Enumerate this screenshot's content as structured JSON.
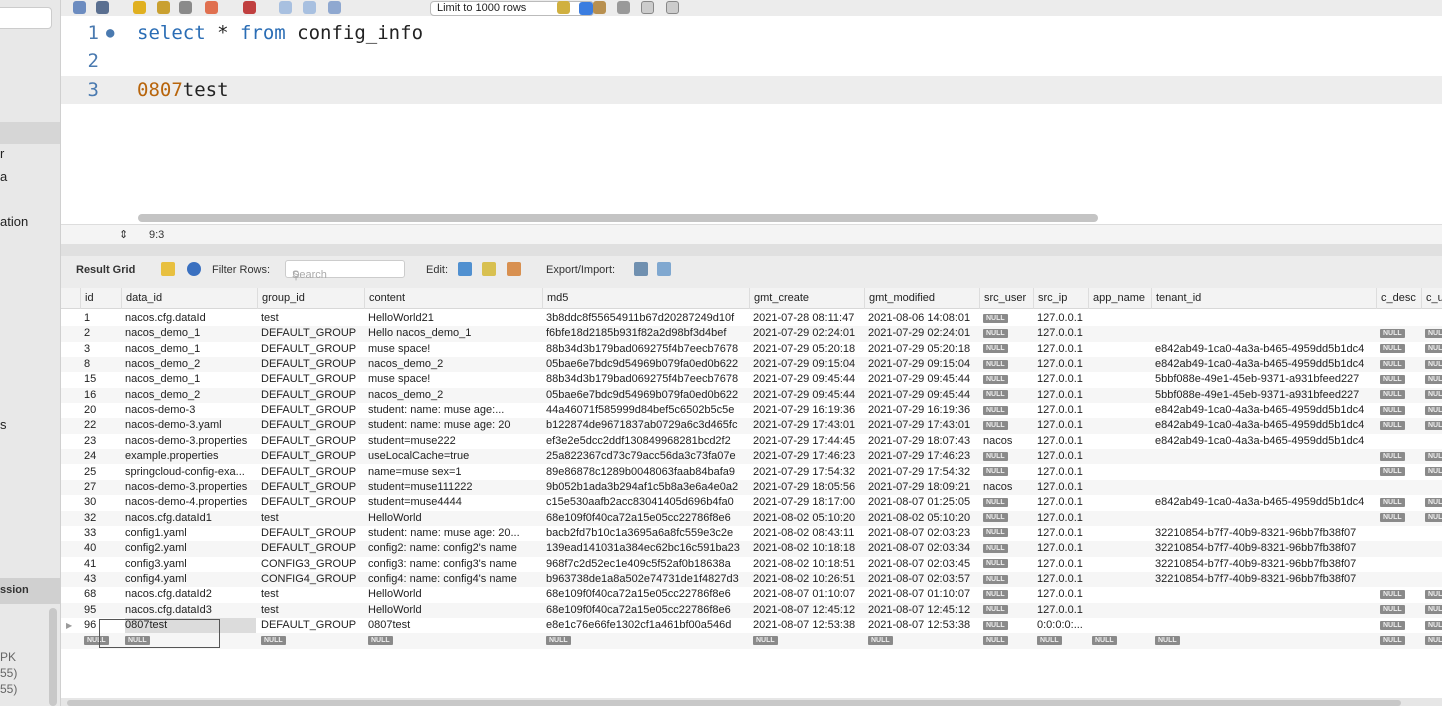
{
  "sidebar": {
    "labels": [
      "r",
      "a",
      "ation",
      "s"
    ],
    "session_header": "ssion",
    "info": [
      "PK",
      "55)",
      "55)"
    ]
  },
  "toolbar": {
    "limit_select": "Limit to 1000 rows"
  },
  "editor": {
    "lines": [
      {
        "num": "1",
        "parts": [
          [
            "kw",
            "select"
          ],
          [
            "",
            " * "
          ],
          [
            "kw",
            "from"
          ],
          [
            "",
            " config_info"
          ]
        ]
      },
      {
        "num": "2",
        "parts": []
      },
      {
        "num": "3",
        "parts": [
          [
            "num",
            "0807"
          ],
          [
            "",
            "test"
          ]
        ]
      }
    ]
  },
  "status": {
    "cursor": "9:3"
  },
  "result_bar": {
    "title": "Result Grid",
    "filter_label": "Filter Rows:",
    "filter_placeholder": "Search",
    "edit_label": "Edit:",
    "export_label": "Export/Import:"
  },
  "grid": {
    "columns": [
      "id",
      "data_id",
      "group_id",
      "content",
      "md5",
      "gmt_create",
      "gmt_modified",
      "src_user",
      "src_ip",
      "app_name",
      "tenant_id",
      "c_desc",
      "c_us"
    ],
    "rows": [
      [
        "1",
        "nacos.cfg.dataId",
        "test",
        "HelloWorld21",
        "3b8ddc8f55654911b67d20287249d10f",
        "2021-07-28 08:11:47",
        "2021-08-06 14:08:01",
        "NULL",
        "127.0.0.1",
        "",
        "",
        "",
        ""
      ],
      [
        "2",
        "nacos_demo_1",
        "DEFAULT_GROUP",
        "Hello nacos_demo_1",
        "f6bfe18d2185b931f82a2d98bf3d4bef",
        "2021-07-29 02:24:01",
        "2021-07-29 02:24:01",
        "NULL",
        "127.0.0.1",
        "",
        "",
        "NULL",
        "NULL"
      ],
      [
        "3",
        "nacos_demo_1",
        "DEFAULT_GROUP",
        "muse space!",
        "88b34d3b179bad069275f4b7eecb7678",
        "2021-07-29 05:20:18",
        "2021-07-29 05:20:18",
        "NULL",
        "127.0.0.1",
        "",
        "e842ab49-1ca0-4a3a-b465-4959dd5b1dc4",
        "NULL",
        "NULL"
      ],
      [
        "8",
        "nacos_demo_2",
        "DEFAULT_GROUP",
        "nacos_demo_2",
        "05bae6e7bdc9d54969b079fa0ed0b622",
        "2021-07-29 09:15:04",
        "2021-07-29 09:15:04",
        "NULL",
        "127.0.0.1",
        "",
        "e842ab49-1ca0-4a3a-b465-4959dd5b1dc4",
        "NULL",
        "NULL"
      ],
      [
        "15",
        "nacos_demo_1",
        "DEFAULT_GROUP",
        "muse space!",
        "88b34d3b179bad069275f4b7eecb7678",
        "2021-07-29 09:45:44",
        "2021-07-29 09:45:44",
        "NULL",
        "127.0.0.1",
        "",
        "5bbf088e-49e1-45eb-9371-a931bfeed227",
        "NULL",
        "NULL"
      ],
      [
        "16",
        "nacos_demo_2",
        "DEFAULT_GROUP",
        "nacos_demo_2",
        "05bae6e7bdc9d54969b079fa0ed0b622",
        "2021-07-29 09:45:44",
        "2021-07-29 09:45:44",
        "NULL",
        "127.0.0.1",
        "",
        "5bbf088e-49e1-45eb-9371-a931bfeed227",
        "NULL",
        "NULL"
      ],
      [
        "20",
        "nacos-demo-3",
        "DEFAULT_GROUP",
        "student:    name: muse     age:...",
        "44a46071f585999d84bef5c6502b5c5e",
        "2021-07-29 16:19:36",
        "2021-07-29 16:19:36",
        "NULL",
        "127.0.0.1",
        "",
        "e842ab49-1ca0-4a3a-b465-4959dd5b1dc4",
        "NULL",
        "NULL"
      ],
      [
        "22",
        "nacos-demo-3.yaml",
        "DEFAULT_GROUP",
        "student:  name: muse  age: 20",
        "b122874de9671837ab0729a6c3d465fc",
        "2021-07-29 17:43:01",
        "2021-07-29 17:43:01",
        "NULL",
        "127.0.0.1",
        "",
        "e842ab49-1ca0-4a3a-b465-4959dd5b1dc4",
        "NULL",
        "NULL"
      ],
      [
        "23",
        "nacos-demo-3.properties",
        "DEFAULT_GROUP",
        "student=muse222",
        "ef3e2e5dcc2ddf130849968281bcd2f2",
        "2021-07-29 17:44:45",
        "2021-07-29 18:07:43",
        "nacos",
        "127.0.0.1",
        "",
        "e842ab49-1ca0-4a3a-b465-4959dd5b1dc4",
        "",
        ""
      ],
      [
        "24",
        "example.properties",
        "DEFAULT_GROUP",
        "useLocalCache=true",
        "25a822367cd73c79acc56da3c73fa07e",
        "2021-07-29 17:46:23",
        "2021-07-29 17:46:23",
        "NULL",
        "127.0.0.1",
        "",
        "",
        "NULL",
        "NULL"
      ],
      [
        "25",
        "springcloud-config-exa...",
        "DEFAULT_GROUP",
        "name=muse sex=1",
        "89e86878c1289b0048063faab84bafa9",
        "2021-07-29 17:54:32",
        "2021-07-29 17:54:32",
        "NULL",
        "127.0.0.1",
        "",
        "",
        "NULL",
        "NULL"
      ],
      [
        "27",
        "nacos-demo-3.properties",
        "DEFAULT_GROUP",
        "student=muse111222",
        "9b052b1ada3b294af1c5b8a3e6a4e0a2",
        "2021-07-29 18:05:56",
        "2021-07-29 18:09:21",
        "nacos",
        "127.0.0.1",
        "",
        "",
        "",
        ""
      ],
      [
        "30",
        "nacos-demo-4.properties",
        "DEFAULT_GROUP",
        "student=muse4444",
        "c15e530aafb2acc83041405d696b4fa0",
        "2021-07-29 18:17:00",
        "2021-08-07 01:25:05",
        "NULL",
        "127.0.0.1",
        "",
        "e842ab49-1ca0-4a3a-b465-4959dd5b1dc4",
        "NULL",
        "NULL"
      ],
      [
        "32",
        "nacos.cfg.dataId1",
        "test",
        "HelloWorld",
        "68e109f0f40ca72a15e05cc22786f8e6",
        "2021-08-02 05:10:20",
        "2021-08-02 05:10:20",
        "NULL",
        "127.0.0.1",
        "",
        "",
        "NULL",
        "NULL"
      ],
      [
        "33",
        "config1.yaml",
        "DEFAULT_GROUP",
        "student:  name: muse  age: 20...",
        "bacb2fd7b10c1a3695a6a8fc559e3c2e",
        "2021-08-02 08:43:11",
        "2021-08-07 02:03:23",
        "NULL",
        "127.0.0.1",
        "",
        "32210854-b7f7-40b9-8321-96bb7fb38f07",
        "",
        ""
      ],
      [
        "40",
        "config2.yaml",
        "DEFAULT_GROUP",
        "config2:  name: config2's name",
        "139ead141031a384ec62bc16c591ba23",
        "2021-08-02 10:18:18",
        "2021-08-07 02:03:34",
        "NULL",
        "127.0.0.1",
        "",
        "32210854-b7f7-40b9-8321-96bb7fb38f07",
        "",
        ""
      ],
      [
        "41",
        "config3.yaml",
        "CONFIG3_GROUP",
        "config3:  name: config3's name",
        "968f7c2d52ec1e409c5f52af0b18638a",
        "2021-08-02 10:18:51",
        "2021-08-07 02:03:45",
        "NULL",
        "127.0.0.1",
        "",
        "32210854-b7f7-40b9-8321-96bb7fb38f07",
        "",
        ""
      ],
      [
        "43",
        "config4.yaml",
        "CONFIG4_GROUP",
        "config4:  name: config4's name",
        "b963738de1a8a502e74731de1f4827d3",
        "2021-08-02 10:26:51",
        "2021-08-07 02:03:57",
        "NULL",
        "127.0.0.1",
        "",
        "32210854-b7f7-40b9-8321-96bb7fb38f07",
        "",
        ""
      ],
      [
        "68",
        "nacos.cfg.dataId2",
        "test",
        "HelloWorld",
        "68e109f0f40ca72a15e05cc22786f8e6",
        "2021-08-07 01:10:07",
        "2021-08-07 01:10:07",
        "NULL",
        "127.0.0.1",
        "",
        "",
        "NULL",
        "NULL"
      ],
      [
        "95",
        "nacos.cfg.dataId3",
        "test",
        "HelloWorld",
        "68e109f0f40ca72a15e05cc22786f8e6",
        "2021-08-07 12:45:12",
        "2021-08-07 12:45:12",
        "NULL",
        "127.0.0.1",
        "",
        "",
        "NULL",
        "NULL"
      ],
      [
        "96",
        "0807test",
        "DEFAULT_GROUP",
        "0807test",
        "e8e1c76e66fe1302cf1a461bf00a546d",
        "2021-08-07 12:53:38",
        "2021-08-07 12:53:38",
        "NULL",
        "0:0:0:0:...",
        "",
        "",
        "NULL",
        "NULL"
      ],
      [
        "NULL",
        "NULL",
        "NULL",
        "NULL",
        "NULL",
        "NULL",
        "NULL",
        "NULL",
        "NULL",
        "NULL",
        "NULL",
        "NULL",
        "NULL"
      ]
    ],
    "selected_row": "96"
  },
  "colors": {
    "keyword": "#2a6db5",
    "number": "#b8650c",
    "null_badge": "#8a8a8a"
  }
}
